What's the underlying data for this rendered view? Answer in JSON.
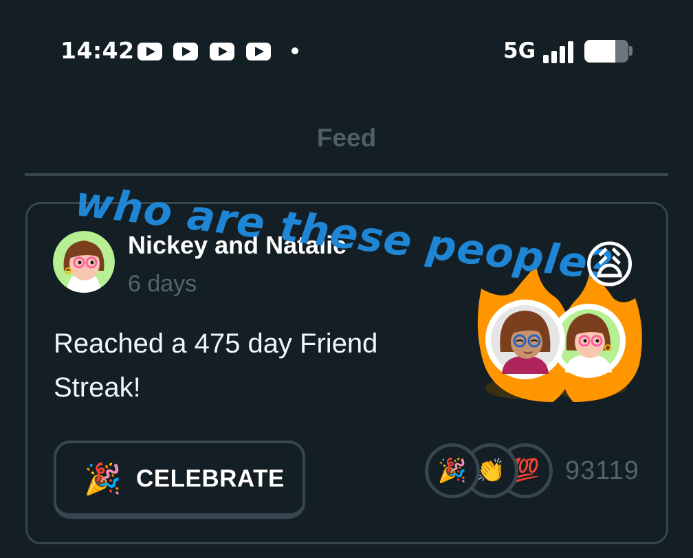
{
  "status_bar": {
    "time": "14:42",
    "notification_icons": [
      "youtube-icon",
      "youtube-icon",
      "youtube-icon",
      "youtube-icon"
    ],
    "network": "5G",
    "signal_bars": 4,
    "battery_level": 0.7
  },
  "header": {
    "title": "Feed"
  },
  "post": {
    "author": "Nickey and Natalie",
    "time_ago": "6 days",
    "text": "Reached a 475 day Friend Streak!",
    "celebrate_icon": "🎉",
    "celebrate_label": "CELEBRATE",
    "reactions": [
      "🎉",
      "👏",
      "💯"
    ],
    "reaction_count": "93119"
  },
  "annotation": {
    "text": "who are these people?",
    "emoji": "😩"
  },
  "colors": {
    "background": "#131f24",
    "border": "#37464f",
    "muted_text": "#52656d",
    "annotation": "#1f86d6",
    "flame": "#ff9600"
  }
}
